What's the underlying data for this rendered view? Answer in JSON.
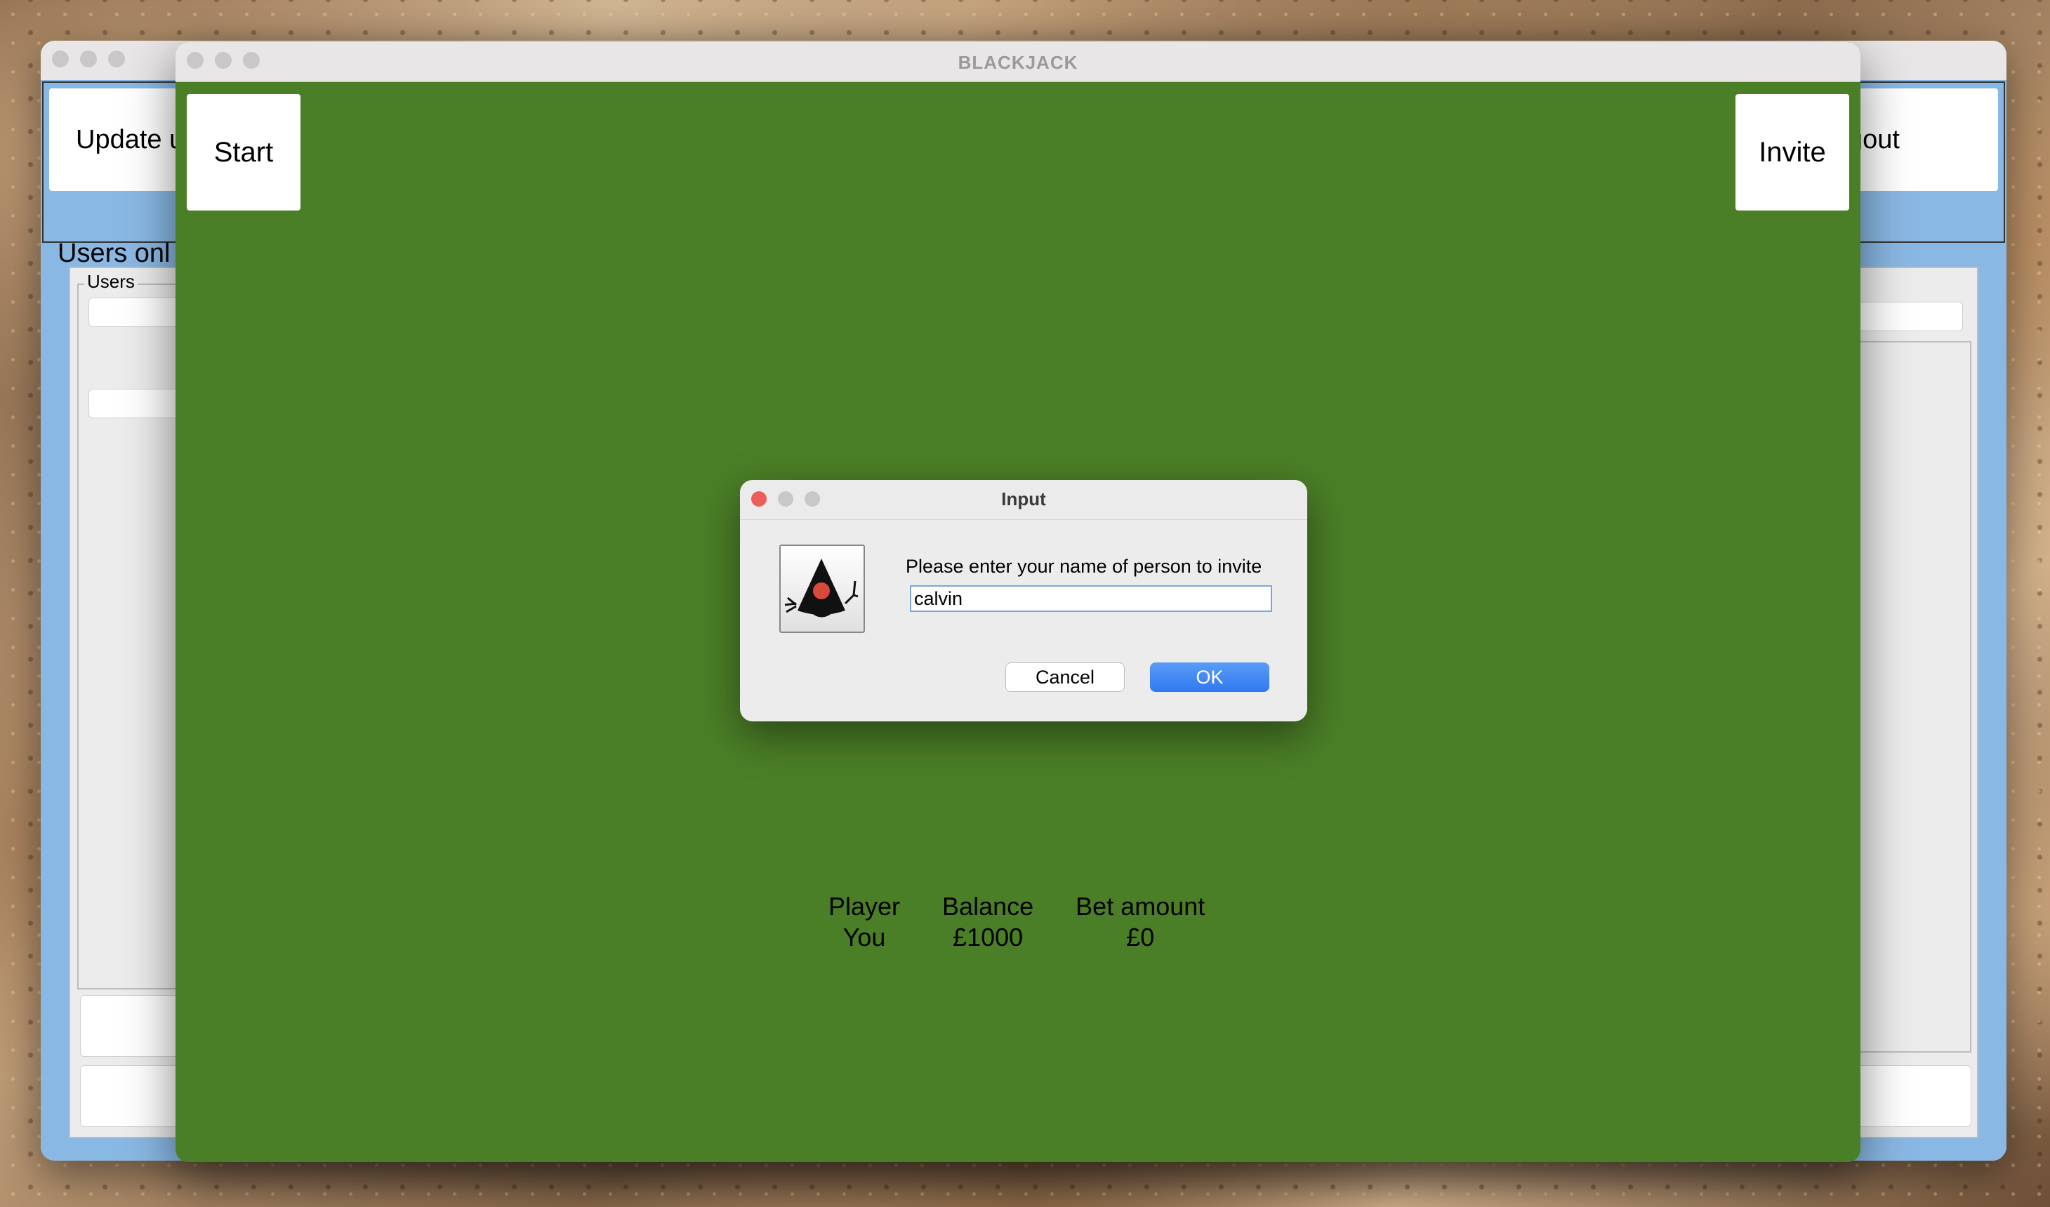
{
  "lobby": {
    "update_button_label": "Update u",
    "logout_button_label": "gout",
    "users_online_label": "Users onl",
    "users_group_label": "Users"
  },
  "game_window": {
    "title": "BLACKJACK",
    "start_button_label": "Start",
    "invite_button_label": "Invite",
    "stats": {
      "player_header": "Player",
      "player_value": "You",
      "balance_header": "Balance",
      "balance_value": "£1000",
      "bet_header": "Bet amount",
      "bet_value": "£0"
    }
  },
  "dialog": {
    "title": "Input",
    "icon": "java-duke-icon",
    "prompt": "Please enter your name of person to invite",
    "input_value": "calvin",
    "cancel_label": "Cancel",
    "ok_label": "OK"
  },
  "colors": {
    "table_green": "#4b7f27",
    "lobby_blue": "#8ab8e4",
    "ok_blue": "#2f78f0",
    "close_red": "#ec5f58"
  }
}
